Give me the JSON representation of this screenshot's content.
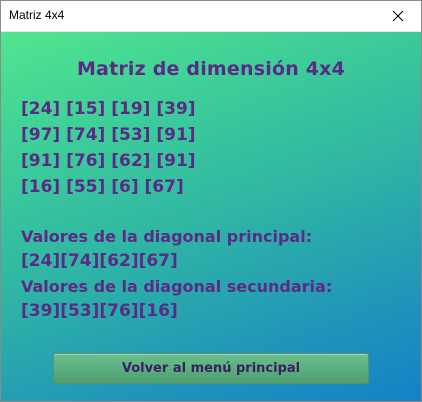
{
  "window": {
    "title": "Matriz 4x4"
  },
  "main": {
    "heading": "Matriz de dimensión 4x4",
    "matrix_rows": [
      "[24] [15] [19] [39]",
      "[97] [74] [53] [91]",
      "[91] [76] [62] [91]",
      "[16] [55] [6] [67]"
    ],
    "main_diagonal_label": "Valores de la diagonal principal:",
    "main_diagonal_values": "[24][74][62][67]",
    "secondary_diagonal_label": "Valores de la diagonal secundaria:",
    "secondary_diagonal_values": "[39][53][76][16]"
  },
  "footer": {
    "back_button_label": "Volver al menú principal"
  },
  "icons": {
    "close": "close-icon"
  },
  "colors": {
    "text": "#5b2a86",
    "gradient_top": "#4fe68e",
    "gradient_bottom": "#1482c6",
    "button": "#5fae7f"
  }
}
